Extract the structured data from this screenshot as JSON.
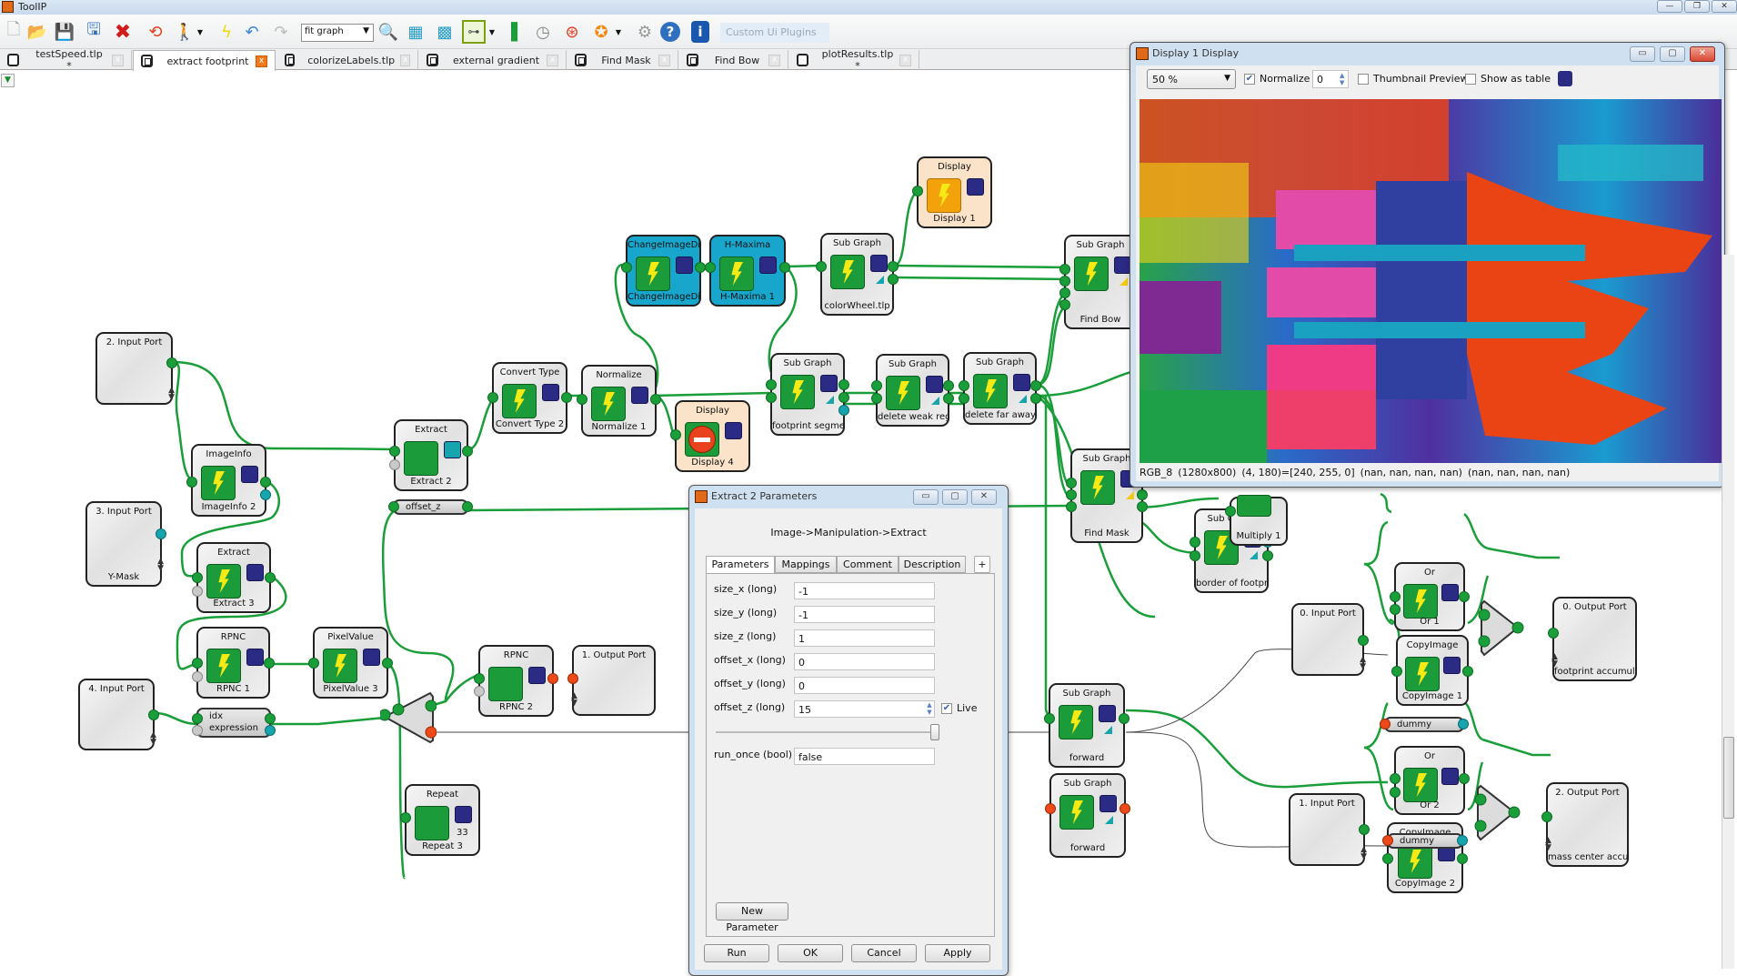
{
  "window": {
    "title": "ToolIP",
    "controls": [
      "minimize",
      "restore",
      "close"
    ]
  },
  "toolbar": {
    "icons": [
      "new-file-icon",
      "open-folder-icon",
      "save-icon",
      "save-as-icon",
      "delete-icon",
      "reload-icon",
      "run-person-icon",
      "run-dropdown-icon",
      "lightning-icon",
      "undo-icon",
      "redo-icon"
    ],
    "zoom_select": "fit graph",
    "icons2": [
      "zoom-magnifier-icon",
      "grid-layout-icon",
      "grid-alt-icon",
      "graph-layout-icon",
      "graph-dropdown-icon",
      "profile-bar-icon",
      "clock-icon",
      "lifebuoy-icon",
      "plugin-wheel-icon",
      "plugin-dropdown-icon",
      "settings-gear-icon",
      "help-icon",
      "info-icon"
    ],
    "custom_plugins": "Custom Ui Plugins"
  },
  "tabs": [
    {
      "label": "testSpeed.tlp *",
      "type": "file",
      "active": false
    },
    {
      "label": "extract footprint",
      "type": "subgraph",
      "active": true
    },
    {
      "label": "colorizeLabels.tlp",
      "type": "subgraph",
      "active": false
    },
    {
      "label": "external gradient",
      "type": "subgraph",
      "active": false
    },
    {
      "label": "Find Mask",
      "type": "subgraph",
      "active": false
    },
    {
      "label": "Find Bow",
      "type": "subgraph",
      "active": false
    },
    {
      "label": "plotResults.tlp *",
      "type": "file",
      "active": false
    }
  ],
  "nodes": {
    "input2": {
      "title": "2. Input Port",
      "name": ""
    },
    "input3": {
      "title": "3. Input Port",
      "name": "Y-Mask"
    },
    "input4": {
      "title": "4. Input Port",
      "name": ""
    },
    "imageinfo": {
      "title": "ImageInfo",
      "name": "ImageInfo 2"
    },
    "extract3": {
      "title": "Extract",
      "name": "Extract 3"
    },
    "rpnc1": {
      "title": "RPNC",
      "name": "RPNC 1"
    },
    "pixelvalue": {
      "title": "PixelValue",
      "name": "PixelValue 3"
    },
    "expression": {
      "line1": "idx",
      "line2": "expression"
    },
    "extract2": {
      "title": "Extract",
      "name": "Extract 2"
    },
    "offset": {
      "label": "offset_z"
    },
    "rpnc2": {
      "title": "RPNC",
      "name": "RPNC 2"
    },
    "output1": {
      "title": "1. Output Port",
      "name": ""
    },
    "repeat": {
      "title": "Repeat",
      "name": "Repeat 3",
      "value": "33"
    },
    "convert": {
      "title": "Convert Type",
      "name": "Convert Type 2"
    },
    "normalize": {
      "title": "Normalize",
      "name": "Normalize 1"
    },
    "display4": {
      "title": "Display",
      "name": "Display 4"
    },
    "change_dims": {
      "title": "ChangeImageDimensions",
      "name": "ChangeImageDimensions"
    },
    "hmaxima": {
      "title": "H-Maxima",
      "name": "H-Maxima 1"
    },
    "colorwheel": {
      "title": "Sub Graph",
      "name": "colorWheel.tlp"
    },
    "display1": {
      "title": "Display",
      "name": "Display 1"
    },
    "fp_seg": {
      "title": "Sub Graph",
      "name": "footprint segmentation"
    },
    "del_weak": {
      "title": "Sub Graph",
      "name": "delete weak region"
    },
    "del_far": {
      "title": "Sub Graph",
      "name": "delete far away region"
    },
    "findbow": {
      "title": "Sub Graph",
      "name": "Find Bow"
    },
    "findmask": {
      "title": "Sub Graph",
      "name": "Find Mask"
    },
    "border": {
      "title": "Sub Graph",
      "name": "border of footprint"
    },
    "multiply": {
      "title": "Multiply",
      "name": "Multiply 1"
    },
    "input0": {
      "title": "0. Input Port",
      "name": ""
    },
    "or1": {
      "title": "Or",
      "name": "Or 1"
    },
    "copy1": {
      "title": "CopyImage",
      "name": "CopyImage 1"
    },
    "output0": {
      "title": "0. Output Port",
      "name": "footprint accumulator"
    },
    "dummy1": {
      "label": "dummy"
    },
    "forward1": {
      "title": "Sub Graph",
      "name": "forward"
    },
    "forward2": {
      "title": "Sub Graph",
      "name": "forward"
    },
    "input1": {
      "title": "1. Input Port",
      "name": ""
    },
    "or2": {
      "title": "Or",
      "name": "Or 2"
    },
    "copy2": {
      "title": "CopyImage",
      "name": "CopyImage 2"
    },
    "output2": {
      "title": "2. Output Port",
      "name": "mass center accumulator"
    },
    "dummy2": {
      "label": "dummy"
    }
  },
  "param_dialog": {
    "title": "Extract 2 Parameters",
    "path": "Image->Manipulation->Extract",
    "tabs": [
      "Parameters",
      "Mappings",
      "Comment",
      "Description"
    ],
    "add_tab": "+",
    "params": [
      {
        "label": "size_x (long)",
        "value": "-1"
      },
      {
        "label": "size_y (long)",
        "value": "-1"
      },
      {
        "label": "size_z (long)",
        "value": "1"
      },
      {
        "label": "offset_x (long)",
        "value": "0"
      },
      {
        "label": "offset_y (long)",
        "value": "0"
      },
      {
        "label": "offset_z (long)",
        "value": "15"
      },
      {
        "label": "run_once (bool)",
        "value": "false"
      }
    ],
    "live_label": "Live",
    "live_checked": true,
    "slider_value_fraction": 1.0,
    "new_param": "New Parameter",
    "buttons": {
      "run": "Run",
      "ok": "OK",
      "cancel": "Cancel",
      "apply": "Apply"
    }
  },
  "display_dialog": {
    "title": "Display 1 Display",
    "zoom": "50 %",
    "normalize_label": "Normalize",
    "normalize_checked": true,
    "channel": "0",
    "thumb_label": "Thumbnail Preview",
    "thumb_checked": false,
    "table_label": "Show as table",
    "table_checked": false,
    "color_swatch": "#2b2a84",
    "status": {
      "type": "RGB_8",
      "size": "(1280x800)",
      "pixel": "(4, 180)=[240, 255, 0]",
      "v1": "(nan, nan, nan, nan)",
      "v2": "(nan, nan, nan, nan)"
    }
  },
  "colors": {
    "wire": "#1a9e3a",
    "node_run": "#1c9b3a",
    "output_box": "#2b2a84",
    "teal_port": "#17a5ad",
    "red_port": "#ee4a19",
    "cyan_node": "#19a6cc",
    "display_node": "#fae3c9"
  }
}
